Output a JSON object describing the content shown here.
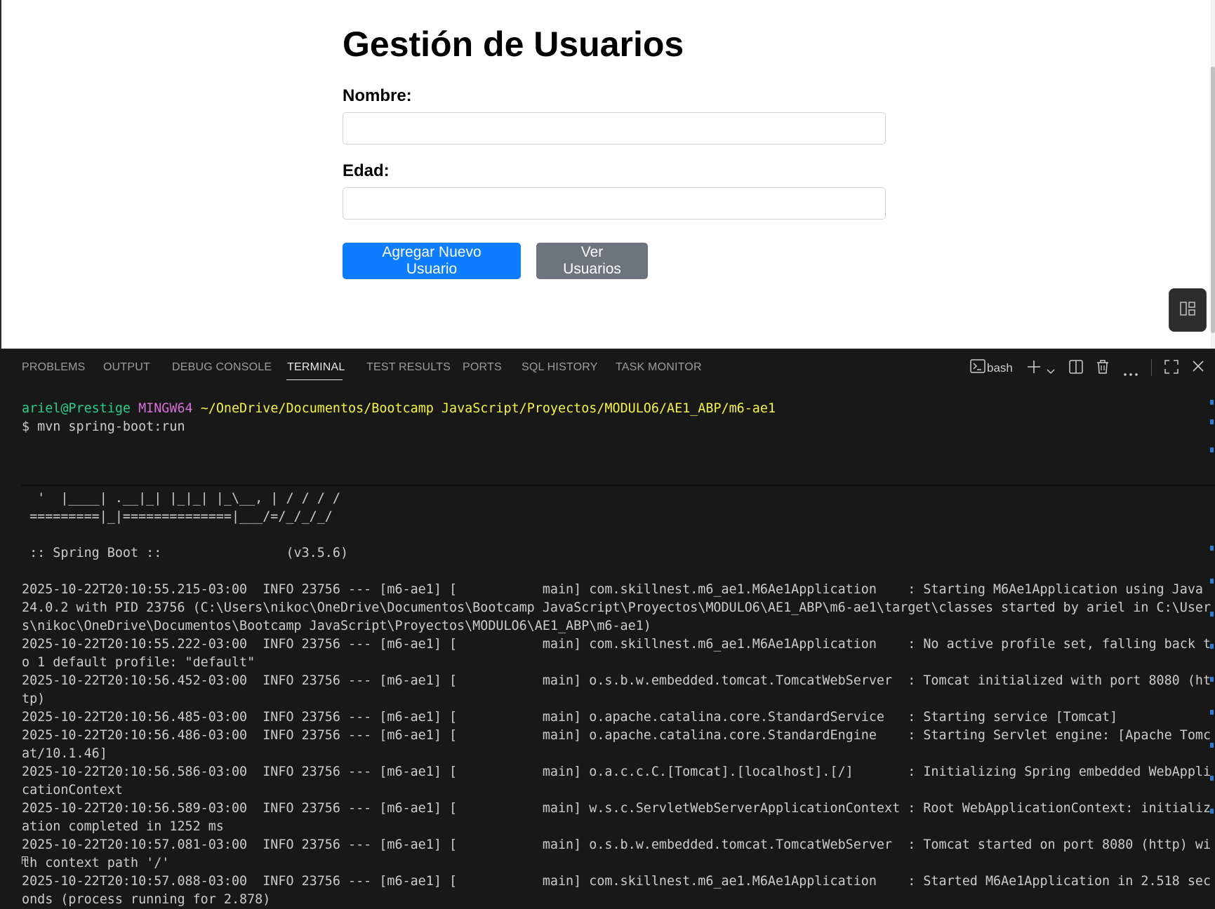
{
  "page": {
    "title": "Gestión de Usuarios",
    "name_label": "Nombre:",
    "name_value": "",
    "age_label": "Edad:",
    "age_value": "",
    "add_button": "Agregar Nuevo Usuario",
    "view_button": "Ver Usuarios",
    "colors": {
      "primary": "#0d7dff",
      "secondary": "#6c757d"
    }
  },
  "panel": {
    "tabs": [
      "PROBLEMS",
      "OUTPUT",
      "DEBUG CONSOLE",
      "TERMINAL",
      "TEST RESULTS",
      "PORTS",
      "SQL HISTORY",
      "TASK MONITOR"
    ],
    "active_tab": "TERMINAL",
    "shell": "bash",
    "tool_icons": [
      "terminal-icon",
      "plus-icon",
      "chevron-down-icon",
      "split-icon",
      "trash-icon",
      "more-icon",
      "maximize-icon",
      "close-icon"
    ]
  },
  "terminal": {
    "user_host": "ariel@Prestige",
    "env": "MINGW64",
    "cwd": "~/OneDrive/Documentos/Bootcamp JavaScript/Proyectos/MODULO6/AE1_ABP/m6-ae1",
    "command": "$ mvn spring-boot:run",
    "lines": [
      "  '  |____| .__|_| |_|_| |_\\__, | / / / /",
      " =========|_|==============|___/=/_/_/_/",
      "",
      " :: Spring Boot ::                (v3.5.6)",
      "",
      "2025-10-22T20:10:55.215-03:00  INFO 23756 --- [m6-ae1] [           main] com.skillnest.m6_ae1.M6Ae1Application    : Starting M6Ae1Application using Java",
      "24.0.2 with PID 23756 (C:\\Users\\nikoc\\OneDrive\\Documentos\\Bootcamp JavaScript\\Proyectos\\MODULO6\\AE1_ABP\\m6-ae1\\target\\classes started by ariel in C:\\User",
      "s\\nikoc\\OneDrive\\Documentos\\Bootcamp JavaScript\\Proyectos\\MODULO6\\AE1_ABP\\m6-ae1)",
      "2025-10-22T20:10:55.222-03:00  INFO 23756 --- [m6-ae1] [           main] com.skillnest.m6_ae1.M6Ae1Application    : No active profile set, falling back t",
      "o 1 default profile: \"default\"",
      "2025-10-22T20:10:56.452-03:00  INFO 23756 --- [m6-ae1] [           main] o.s.b.w.embedded.tomcat.TomcatWebServer  : Tomcat initialized with port 8080 (ht",
      "tp)",
      "2025-10-22T20:10:56.485-03:00  INFO 23756 --- [m6-ae1] [           main] o.apache.catalina.core.StandardService   : Starting service [Tomcat]",
      "2025-10-22T20:10:56.486-03:00  INFO 23756 --- [m6-ae1] [           main] o.apache.catalina.core.StandardEngine    : Starting Servlet engine: [Apache Tomc",
      "at/10.1.46]",
      "2025-10-22T20:10:56.586-03:00  INFO 23756 --- [m6-ae1] [           main] o.a.c.c.C.[Tomcat].[localhost].[/]       : Initializing Spring embedded WebAppli",
      "cationContext",
      "2025-10-22T20:10:56.589-03:00  INFO 23756 --- [m6-ae1] [           main] w.s.c.ServletWebServerApplicationContext : Root WebApplicationContext: initializ",
      "ation completed in 1252 ms",
      "2025-10-22T20:10:57.081-03:00  INFO 23756 --- [m6-ae1] [           main] o.s.b.w.embedded.tomcat.TomcatWebServer  : Tomcat started on port 8080 (http) wi",
      "th context path '/'",
      "2025-10-22T20:10:57.088-03:00  INFO 23756 --- [m6-ae1] [           main] com.skillnest.m6_ae1.M6Ae1Application    : Started M6Ae1Application in 2.518 sec",
      "onds (process running for 2.878)"
    ]
  }
}
